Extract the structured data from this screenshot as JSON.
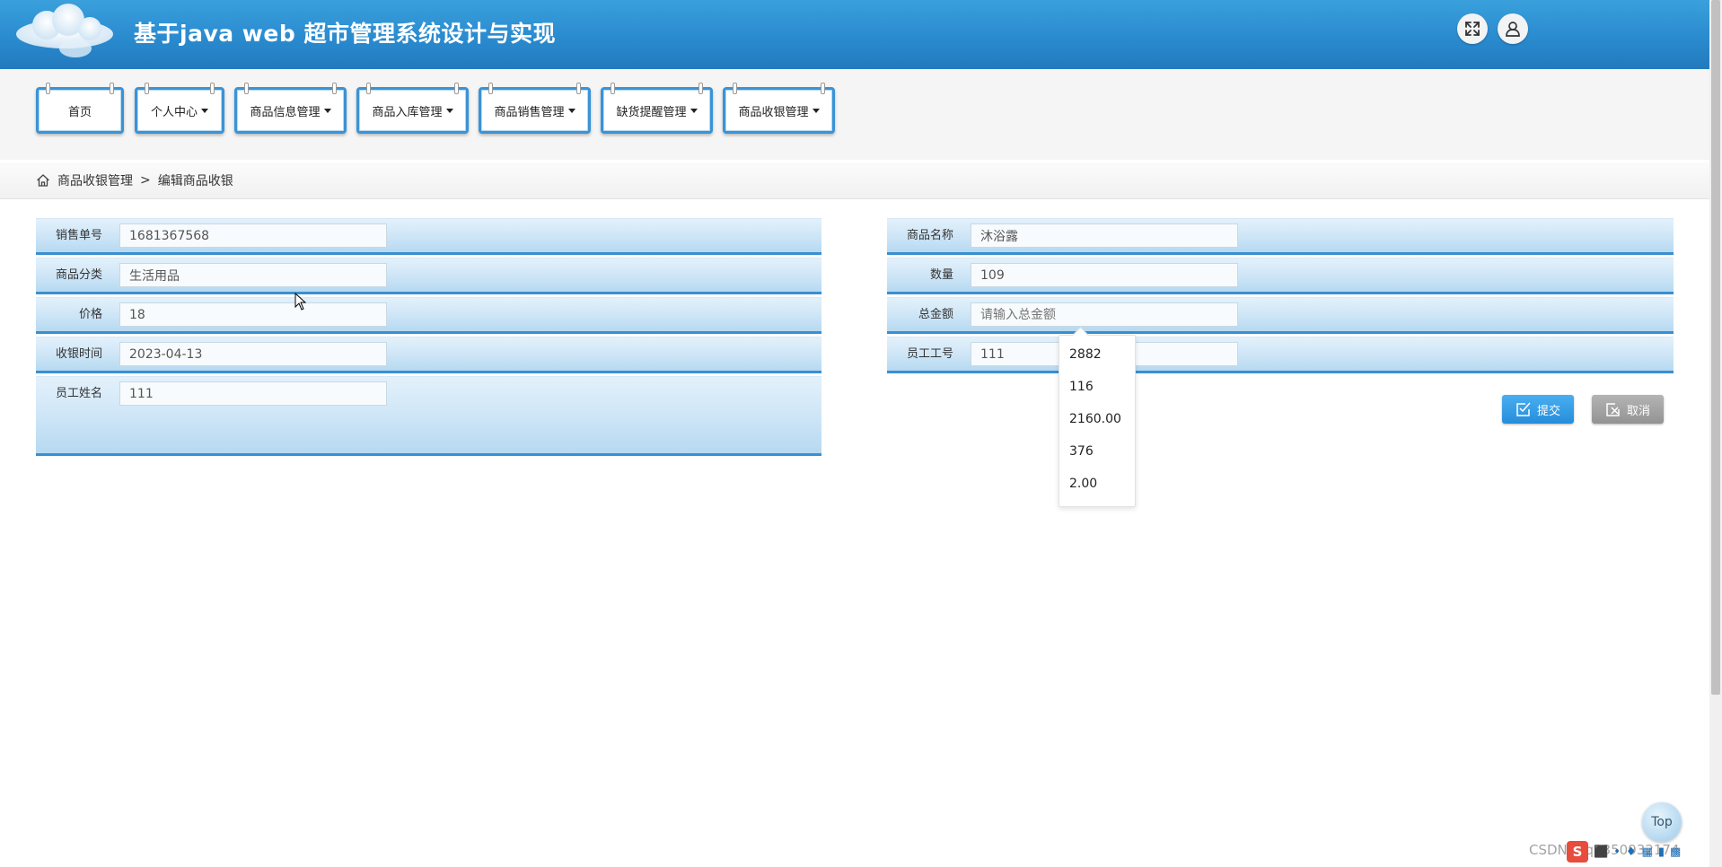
{
  "header": {
    "title": "基于java web 超市管理系统设计与实现",
    "fullscreen_icon": "expand-icon",
    "user_icon": "user-icon"
  },
  "nav": {
    "items": [
      {
        "label": "首页",
        "has_caret": false
      },
      {
        "label": "个人中心",
        "has_caret": true
      },
      {
        "label": "商品信息管理",
        "has_caret": true
      },
      {
        "label": "商品入库管理",
        "has_caret": true
      },
      {
        "label": "商品销售管理",
        "has_caret": true
      },
      {
        "label": "缺货提醒管理",
        "has_caret": true
      },
      {
        "label": "商品收银管理",
        "has_caret": true
      }
    ]
  },
  "breadcrumb": {
    "icon": "home-icon",
    "section": "商品收银管理",
    "separator": ">",
    "current": "编辑商品收银"
  },
  "form": {
    "left": [
      {
        "label": "销售单号",
        "value": "1681367568"
      },
      {
        "label": "商品分类",
        "value": "生活用品"
      },
      {
        "label": "价格",
        "value": "18"
      },
      {
        "label": "收银时间",
        "value": "2023-04-13"
      },
      {
        "label": "员工姓名",
        "value": "111"
      }
    ],
    "right": [
      {
        "label": "商品名称",
        "value": "沐浴露"
      },
      {
        "label": "数量",
        "value": "109"
      },
      {
        "label": "总金额",
        "value": "",
        "placeholder": "请输入总金额"
      },
      {
        "label": "员工工号",
        "value": "111"
      }
    ]
  },
  "autocomplete": {
    "options": [
      "2882",
      "116",
      "2160.00",
      "376",
      "2.00"
    ]
  },
  "buttons": {
    "submit_label": "提交",
    "cancel_label": "取消"
  },
  "scroll_top_label": "Top",
  "watermark": "CSDN @q3350932174",
  "colors": {
    "header_blue": "#2a8bcf",
    "row_border": "#3a8fd0",
    "submit_blue": "#258ddb",
    "cancel_gray": "#939393"
  }
}
